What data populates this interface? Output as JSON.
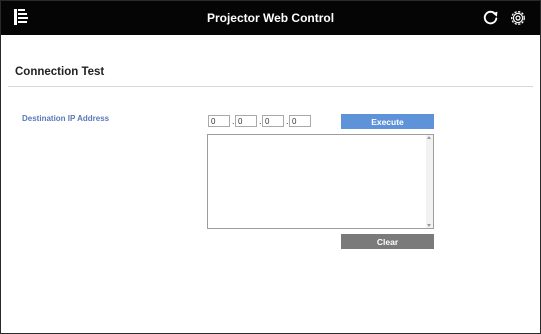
{
  "header": {
    "title": "Projector Web Control",
    "menu_icon": "menu-icon",
    "refresh_icon": "refresh-icon",
    "settings_icon": "gear-icon",
    "background_color": "#050505"
  },
  "page": {
    "section_title": "Connection Test",
    "destination_label": "Destination IP Address",
    "ip_address": {
      "octets": [
        "0",
        "0",
        "0",
        "0"
      ],
      "separator": "."
    },
    "execute_label": "Execute",
    "clear_label": "Clear",
    "result_text": "",
    "colors": {
      "label": "#5b79b7",
      "execute_button": "#5f93d9",
      "clear_button": "#7a7a7a"
    }
  }
}
